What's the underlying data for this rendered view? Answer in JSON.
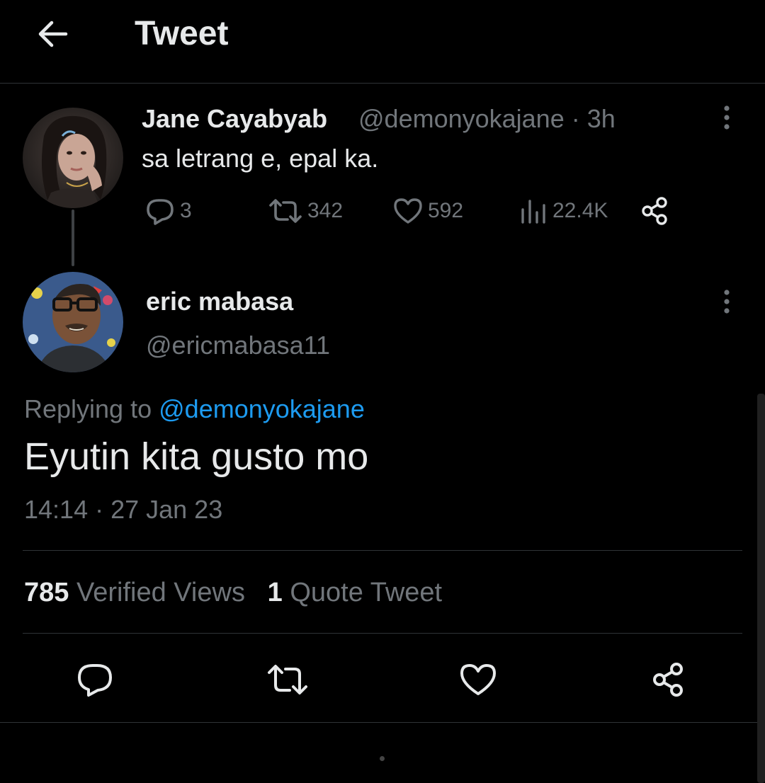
{
  "header": {
    "title": "Tweet",
    "back_icon": "arrow-left-icon"
  },
  "parent_tweet": {
    "author_name": "Jane Cayabyab",
    "meta": "@demonyokajane · 3h",
    "text": "sa letrang e, epal ka.",
    "actions": {
      "replies": "3",
      "retweets": "342",
      "likes": "592",
      "views": "22.4K"
    }
  },
  "reply_tweet": {
    "author_name": "eric mabasa",
    "handle": "@ericmabasa11",
    "replying_prefix": "Replying to",
    "replying_to": "@demonyokajane",
    "text": "Eyutin kita gusto mo",
    "timestamp": "14:14 · 27 Jan 23",
    "stats": {
      "views_count": "785",
      "views_label": "Verified Views",
      "quotes_count": "1",
      "quotes_label": "Quote Tweet"
    }
  },
  "colors": {
    "background": "#000000",
    "text_primary": "#e7e9ea",
    "text_secondary": "#71767b",
    "link": "#1d9bf0",
    "divider": "#2f3336"
  }
}
